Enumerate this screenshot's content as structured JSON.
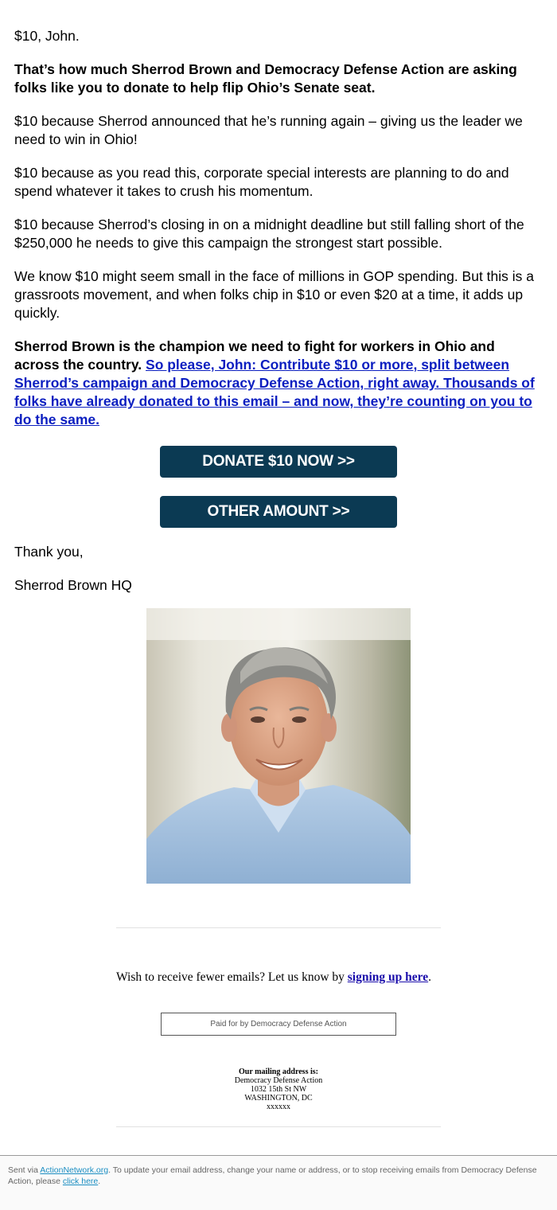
{
  "email": {
    "greeting": "$10, John.",
    "intro_bold": "That’s how much Sherrod Brown and Democracy Defense Action are asking folks like you to donate to help flip Ohio’s Senate seat.",
    "para1": "$10 because Sherrod announced that he’s running again – giving us the leader we need to win in Ohio!",
    "para2": "$10 because as you read this, corporate special interests are planning to do and spend whatever it takes to crush his momentum.",
    "para3": "$10 because Sherrod’s closing in on a midnight deadline but still falling short of the $250,000 he needs to give this campaign the strongest start possible.",
    "para4": "We know $10 might seem small in the face of millions in GOP spending. But this is a grassroots movement, and when folks chip in $10 or even $20 at a time, it adds up quickly.",
    "para5_bold": "Sherrod Brown is the champion we need to fight for workers in Ohio and across the country.",
    "para5_link": "So please, John: Contribute $10 or more, split between Sherrod’s campaign and Democracy Defense Action, right away. Thousands of folks have already donated to this email – and now, they’re counting on you to do the same.",
    "donate_button": "DONATE $10 NOW >>",
    "other_button": "OTHER AMOUNT >>",
    "sign_off": "Thank you,",
    "signature": "Sherrod Brown HQ"
  },
  "preferences": {
    "text": "Wish to receive fewer emails? Let us know by ",
    "link": "signing up here",
    "end": "."
  },
  "disclaimer": "Paid for by Democracy Defense Action",
  "address": {
    "label": "Our mailing address is:",
    "line1": "Democracy Defense Action",
    "line2": "1032 15th St NW",
    "line3": "WASHINGTON, DC",
    "line4": "xxxxxx"
  },
  "footer": {
    "prefix": "Sent via ",
    "site_link": "ActionNetwork.org",
    "middle": ". To update your email address, change your name or address, or to stop receiving emails from Democracy Defense Action, please ",
    "click_link": "click here",
    "end": "."
  },
  "colors": {
    "button_bg": "#0b3a53",
    "link": "#0b1ec0"
  }
}
